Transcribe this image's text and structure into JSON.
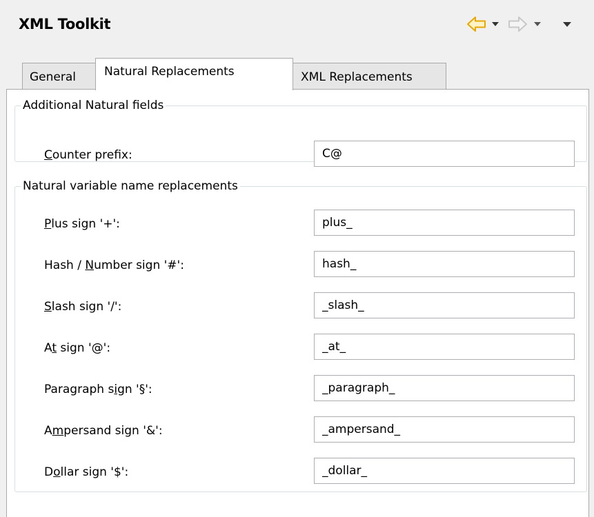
{
  "header": {
    "title": "XML Toolkit",
    "icons": {
      "back": "arrow-left-icon",
      "back_dropdown": "chevron-down-icon",
      "forward": "arrow-right-icon",
      "forward_dropdown": "chevron-down-icon",
      "view_menu": "view-menu-icon"
    },
    "colors": {
      "back_arrow": "#e8a800",
      "forward_arrow": "#c8c8c8"
    }
  },
  "tabs": [
    {
      "label": "General",
      "selected": false
    },
    {
      "label": "Natural Replacements",
      "selected": true
    },
    {
      "label": "XML Replacements",
      "selected": false
    }
  ],
  "groups": {
    "additional": {
      "legend": "Additional Natural fields",
      "rows": [
        {
          "pre": "",
          "mnemonic": "C",
          "post": "ounter prefix:",
          "value": "C@"
        }
      ]
    },
    "replacements": {
      "legend": "Natural variable name replacements",
      "rows": [
        {
          "pre": "",
          "mnemonic": "P",
          "post": "lus sign '+':",
          "value": "plus_"
        },
        {
          "pre": "Hash / ",
          "mnemonic": "N",
          "post": "umber sign '#':",
          "value": "hash_"
        },
        {
          "pre": "",
          "mnemonic": "S",
          "post": "lash sign '/':",
          "value": "_slash_"
        },
        {
          "pre": "A",
          "mnemonic": "t",
          "post": " sign '@':",
          "value": "_at_"
        },
        {
          "pre": "Paragraph s",
          "mnemonic": "i",
          "post": "gn '§':",
          "value": "_paragraph_"
        },
        {
          "pre": "A",
          "mnemonic": "m",
          "post": "persand sign '&':",
          "value": "_ampersand_"
        },
        {
          "pre": "D",
          "mnemonic": "o",
          "post": "llar sign '$':",
          "value": "_dollar_"
        }
      ]
    }
  }
}
